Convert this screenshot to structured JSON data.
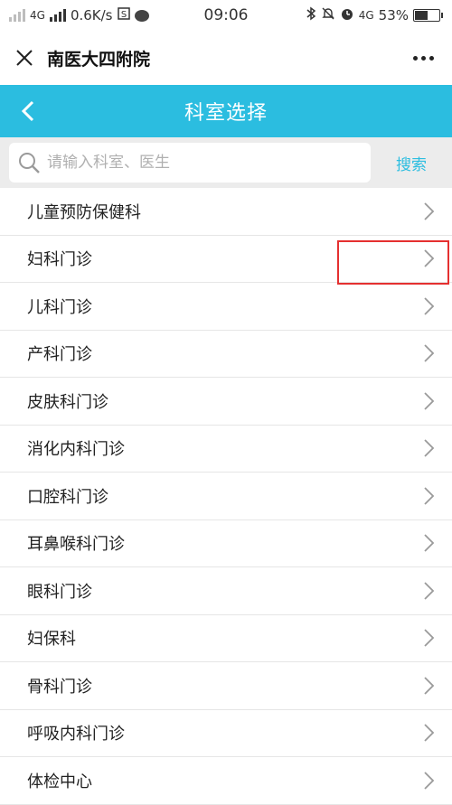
{
  "status_bar": {
    "network_left": "4G",
    "speed": "0.6K/s",
    "time": "09:06",
    "network_right": "4G",
    "battery_percent": "53%",
    "battery_level": 0.53
  },
  "title_bar": {
    "title": "南医大四附院"
  },
  "header": {
    "title": "科室选择"
  },
  "search": {
    "placeholder": "请输入科室、医生",
    "button_label": "搜索"
  },
  "departments": [
    "儿童预防保健科",
    "妇科门诊",
    "儿科门诊",
    "产科门诊",
    "皮肤科门诊",
    "消化内科门诊",
    "口腔科门诊",
    "耳鼻喉科门诊",
    "眼科门诊",
    "妇保科",
    "骨科门诊",
    "呼吸内科门诊",
    "体检中心"
  ],
  "colors": {
    "accent": "#2bbde0",
    "highlight": "#e53030"
  }
}
